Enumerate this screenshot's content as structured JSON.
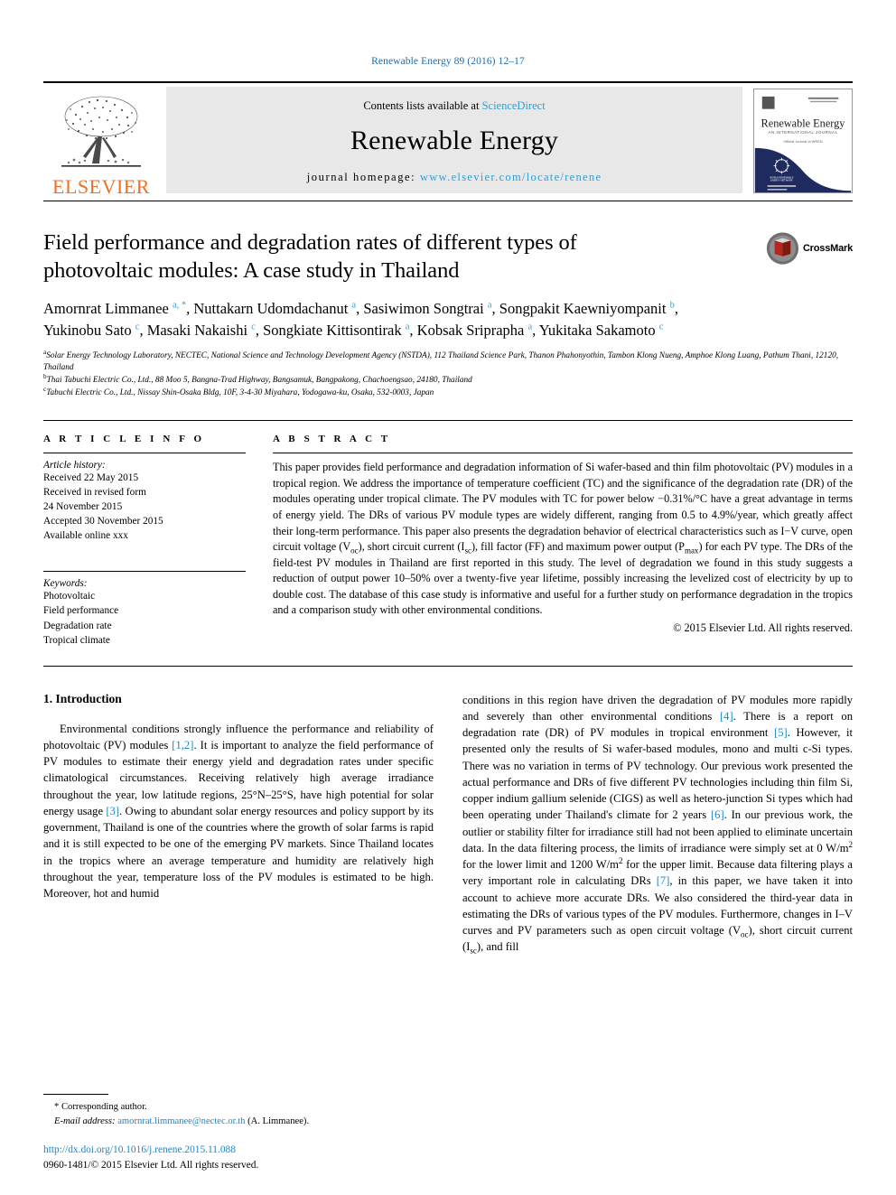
{
  "running_head": "Renewable Energy 89 (2016) 12–17",
  "masthead": {
    "publisher_name": "ELSEVIER",
    "contents_prefix": "Contents lists available at ",
    "contents_link": "ScienceDirect",
    "journal_title": "Renewable Energy",
    "homepage_prefix": "journal homepage: ",
    "homepage_url": "www.elsevier.com/locate/renene",
    "cover_title": "Renewable Energy",
    "cover_subtitle": "AN INTERNATIONAL JOURNAL",
    "cover_tagline": "Official Journal of WREN"
  },
  "crossmark": {
    "label": "CrossMark"
  },
  "article": {
    "title": "Field performance and degradation rates of different types of photovoltaic modules: A case study in Thailand",
    "authors_html": "Amornrat Limmanee <sup class=\"aff-mark\">a, *</sup>, Nuttakarn Udomdachanut <sup class=\"aff-mark\">a</sup>, Sasiwimon Songtrai <sup class=\"aff-mark\">a</sup>, Songpakit Kaewniyompanit <sup class=\"aff-mark\">b</sup>, Yukinobu Sato <sup class=\"aff-mark\">c</sup>, Masaki Nakaishi <sup class=\"aff-mark\">c</sup>, Songkiate Kittisontirak <sup class=\"aff-mark\">a</sup>, Kobsak Sriprapha <sup class=\"aff-mark\">a</sup>, Yukitaka Sakamoto <sup class=\"aff-mark\">c</sup>",
    "affiliations": [
      {
        "mark": "a",
        "text": "Solar Energy Technology Laboratory, NECTEC, National Science and Technology Development Agency (NSTDA), 112 Thailand Science Park, Thanon Phahonyothin, Tambon Klong Nueng, Amphoe Klong Luang, Pathum Thani, 12120, Thailand"
      },
      {
        "mark": "b",
        "text": "Thai Tabuchi Electric Co., Ltd., 88 Moo 5, Bangna-Trad Highway, Bangsamuk, Bangpakong, Chachoengsao, 24180, Thailand"
      },
      {
        "mark": "c",
        "text": "Tabuchi Electric Co., Ltd., Nissay Shin-Osaka Bldg, 10F, 3-4-30 Miyahara, Yodogawa-ku, Osaka, 532-0003, Japan"
      }
    ]
  },
  "article_info": {
    "heading": "A R T I C L E  I N F O",
    "history_label": "Article history:",
    "history": [
      "Received 22 May 2015",
      "Received in revised form",
      "24 November 2015",
      "Accepted 30 November 2015",
      "Available online xxx"
    ],
    "keywords_label": "Keywords:",
    "keywords": [
      "Photovoltaic",
      "Field performance",
      "Degradation rate",
      "Tropical climate"
    ]
  },
  "abstract": {
    "heading": "A B S T R A C T",
    "body_html": "This paper provides field performance and degradation information of Si wafer-based and thin film photovoltaic (PV) modules in a tropical region. We address the importance of temperature coefficient (TC) and the significance of the degradation rate (DR) of the modules operating under tropical climate. The PV modules with TC for power below &minus;0.31%/&deg;C have a great advantage in terms of energy yield. The DRs of various PV module types are widely different, ranging from 0.5 to 4.9%/year, which greatly affect their long-term performance. This paper also presents the degradation behavior of electrical characteristics such as I&minus;V curve, open circuit voltage (V<sub>oc</sub>), short circuit current (I<sub>sc</sub>), fill factor (FF) and maximum power output (P<sub>max</sub>) for each PV type. The DRs of the field-test PV modules in Thailand are first reported in this study. The level of degradation we found in this study suggests a reduction of output power 10&ndash;50% over a twenty-five year lifetime, possibly increasing the levelized cost of electricity by up to double cost. The database of this case study is informative and useful for a further study on performance degradation in the tropics and a comparison study with other environmental conditions.",
    "copyright": "© 2015 Elsevier Ltd. All rights reserved."
  },
  "introduction": {
    "section_title": "1. Introduction",
    "left_paragraph_html": "Environmental conditions strongly influence the performance and reliability of photovoltaic (PV) modules <span class=\"ref\">[1,2]</span>. It is important to analyze the field performance of PV modules to estimate their energy yield and degradation rates under specific climatological circumstances. Receiving relatively high average irradiance throughout the year, low latitude regions, 25&deg;N&ndash;25&deg;S, have high potential for solar energy usage <span class=\"ref\">[3]</span>. Owing to abundant solar energy resources and policy support by its government, Thailand is one of the countries where the growth of solar farms is rapid and it is still expected to be one of the emerging PV markets. Since Thailand locates in the tropics where an average temperature and humidity are relatively high throughout the year, temperature loss of the PV modules is estimated to be high. Moreover, hot and humid",
    "right_paragraph_html": "conditions in this region have driven the degradation of PV modules more rapidly and severely than other environmental conditions <span class=\"ref\">[4]</span>. There is a report on degradation rate (DR) of PV modules in tropical environment <span class=\"ref\">[5]</span>. However, it presented only the results of Si wafer-based modules, mono and multi c-Si types. There was no variation in terms of PV technology. Our previous work presented the actual performance and DRs of five different PV technologies including thin film Si, copper indium gallium selenide (CIGS) as well as hetero-junction Si types which had been operating under Thailand's climate for 2 years <span class=\"ref\">[6]</span>. In our previous work, the outlier or stability filter for irradiance still had not been applied to eliminate uncertain data. In the data filtering process, the limits of irradiance were simply set at 0 W/m<sup>2</sup> for the lower limit and 1200 W/m<sup>2</sup> for the upper limit. Because data filtering plays a very important role in calculating DRs <span class=\"ref\">[7]</span>, in this paper, we have taken it into account to achieve more accurate DRs. We also considered the third-year data in estimating the DRs of various types of the PV modules. Furthermore, changes in I&ndash;V curves and PV parameters such as open circuit voltage (V<sub>oc</sub>), short circuit current (I<sub>sc</sub>), and fill"
  },
  "footnote": {
    "corresponding_marker": "*",
    "corresponding_label": "Corresponding author.",
    "email_label": "E-mail address:",
    "email": "amornrat.limmanee@nectec.or.th",
    "email_suffix": "(A. Limmanee).",
    "doi": "http://dx.doi.org/10.1016/j.renene.2015.11.088",
    "issn_line": "0960-1481/© 2015 Elsevier Ltd. All rights reserved."
  },
  "colors": {
    "link_blue": "#1f86c4",
    "sciencedirect_blue": "#2f9fd0",
    "elsevier_orange": "#ea7125",
    "band_gray": "#e8e8e8",
    "cover_navy": "#1f2a5e",
    "cover_gold": "#d4a72c",
    "crossmark_red": "#b5281e"
  }
}
